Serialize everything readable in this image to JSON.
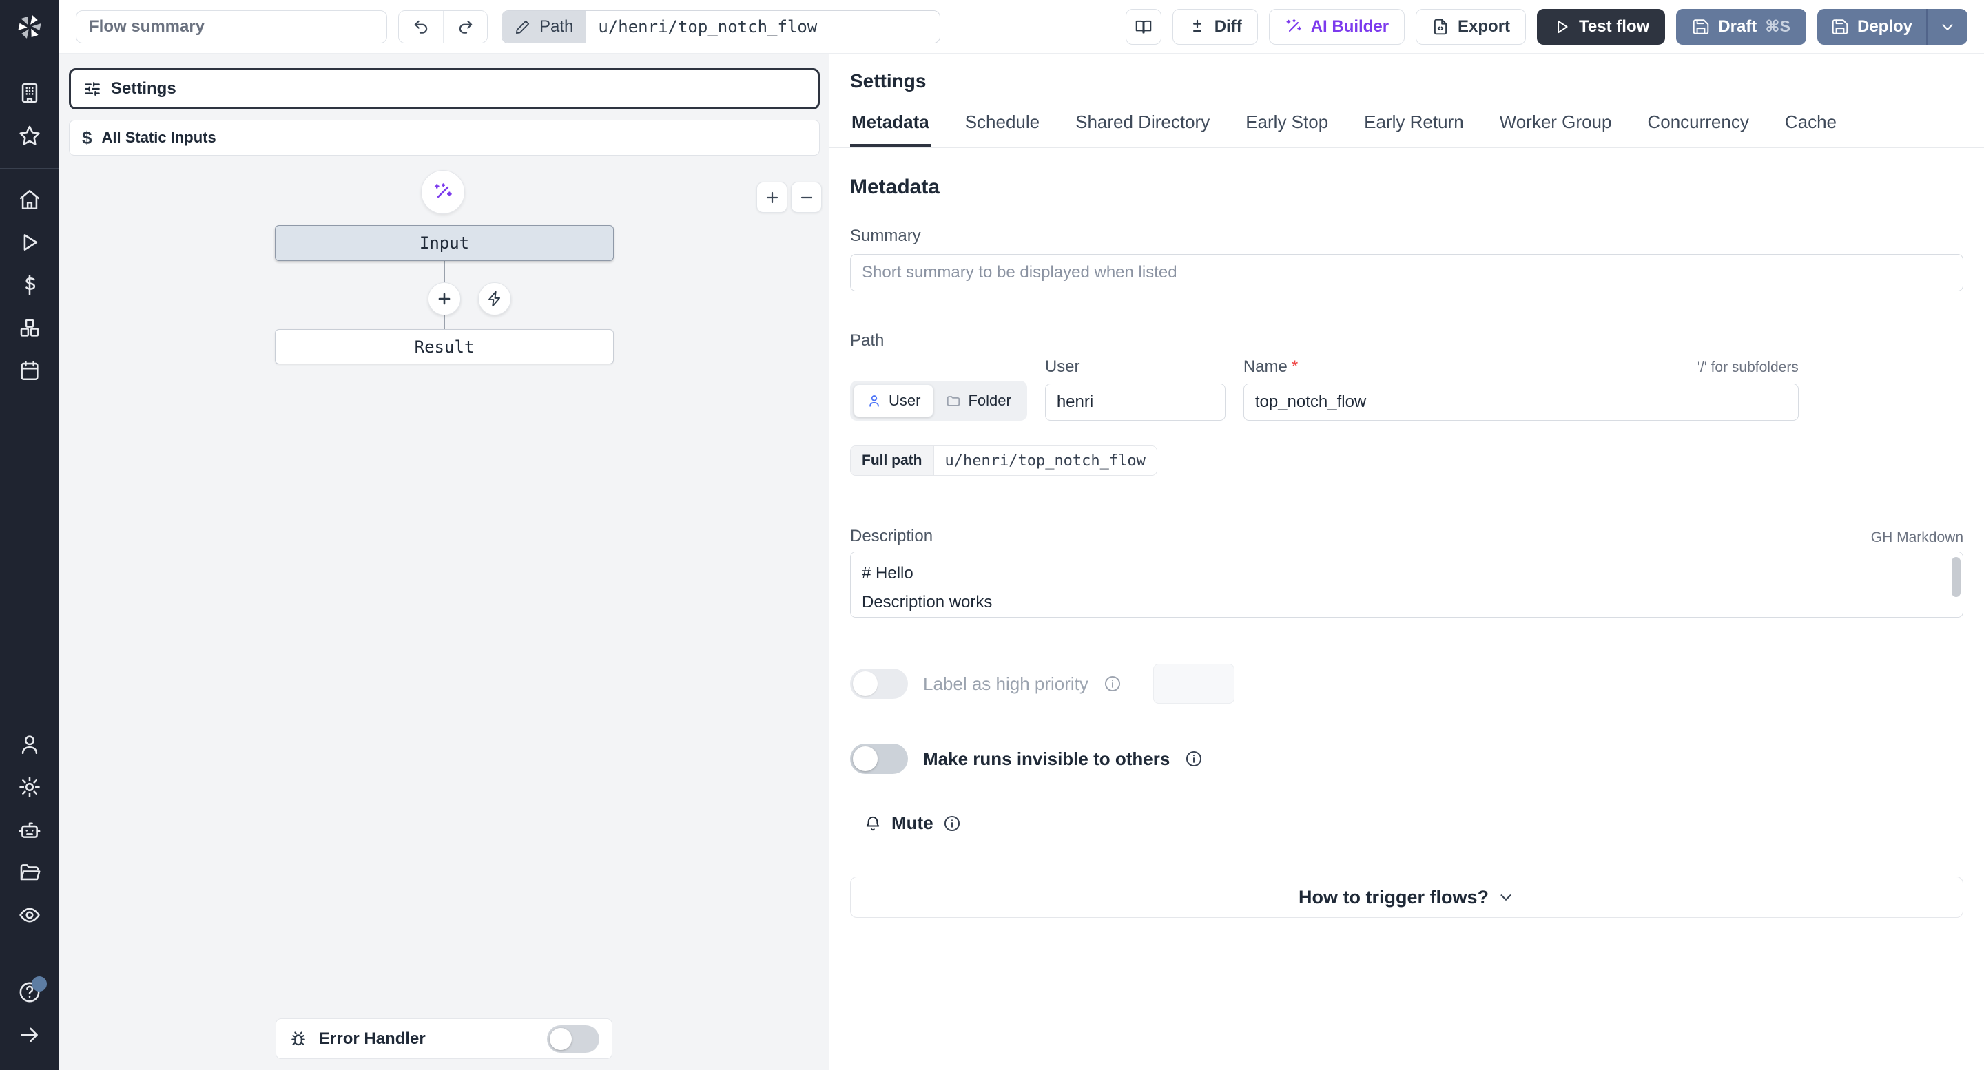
{
  "topbar": {
    "flow_summary_placeholder": "Flow summary",
    "path_button_label": "Path",
    "path_value": "u/henri/top_notch_flow",
    "diff_label": "Diff",
    "ai_builder_label": "AI Builder",
    "export_label": "Export",
    "test_flow_label": "Test flow",
    "draft_label": "Draft",
    "draft_shortcut": "⌘S",
    "deploy_label": "Deploy"
  },
  "sidebar": {
    "icons": [
      "windmill-logo",
      "building",
      "star",
      "home",
      "play",
      "dollar",
      "boxes",
      "calendar",
      "user",
      "settings-gear",
      "worker-bot",
      "folder",
      "eye",
      "help",
      "expand-arrow"
    ]
  },
  "flow_panel": {
    "settings_label": "Settings",
    "static_inputs_label": "All Static Inputs",
    "dollar_glyph": "$",
    "input_node_label": "Input",
    "result_node_label": "Result",
    "error_handler_label": "Error Handler"
  },
  "settings_panel": {
    "title": "Settings",
    "tabs": [
      "Metadata",
      "Schedule",
      "Shared Directory",
      "Early Stop",
      "Early Return",
      "Worker Group",
      "Concurrency",
      "Cache"
    ],
    "active_tab": "Metadata",
    "metadata": {
      "heading": "Metadata",
      "summary_label": "Summary",
      "summary_placeholder": "Short summary to be displayed when listed",
      "path_section_label": "Path",
      "owner_kind_user": "User",
      "owner_kind_folder": "Folder",
      "owner_kind_active": "User",
      "user_label": "User",
      "user_value": "henri",
      "name_label": "Name",
      "required_asterisk": "*",
      "name_value": "top_notch_flow",
      "subfolders_hint": "'/' for subfolders",
      "full_path_label": "Full path",
      "full_path_value": "u/henri/top_notch_flow",
      "description_label": "Description",
      "markdown_badge": "GH Markdown",
      "description_value": "# Hello\nDescription works",
      "high_priority_label": "Label as high priority",
      "high_priority_enabled": false,
      "invisible_runs_label": "Make runs invisible to others",
      "invisible_runs_enabled": false,
      "mute_label": "Mute",
      "trigger_collapse_label": "How to trigger flows?"
    }
  },
  "colors": {
    "rail_background": "#1f2430",
    "accent_dark": "#2e3440",
    "frost_blue": "#64799c",
    "brand_purple": "#7c3aed",
    "user_icon_blue": "#4d74f7",
    "required_red": "#ef4444",
    "canvas_gray": "#f3f4f6",
    "input_node_fill": "#dce3eb"
  }
}
